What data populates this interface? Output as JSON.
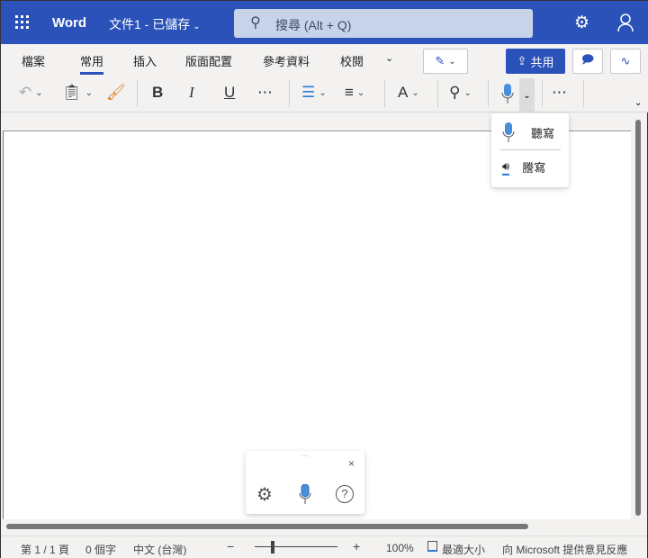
{
  "titlebar": {
    "app_name": "Word",
    "doc_name": "文件1 - 已儲存",
    "search_placeholder": "搜尋 (Alt + Q)"
  },
  "ribbon": {
    "tabs": [
      "檔案",
      "常用",
      "插入",
      "版面配置",
      "參考資料",
      "校閱"
    ],
    "active_tab": "常用",
    "share_label": "共用"
  },
  "dictate_menu": {
    "items": [
      "聽寫",
      "謄寫"
    ]
  },
  "status": {
    "page": "第 1 / 1 頁",
    "words": "0 個字",
    "language": "中文 (台灣)",
    "zoom_minus": "−",
    "zoom_plus": "+",
    "zoom_level": "100%",
    "fit": "最適大小",
    "feedback": "向 Microsoft 提供意見反應"
  },
  "zoom_percent": 100,
  "colors": {
    "brand": "#2b52b9",
    "mic": "#4a8fd9"
  }
}
